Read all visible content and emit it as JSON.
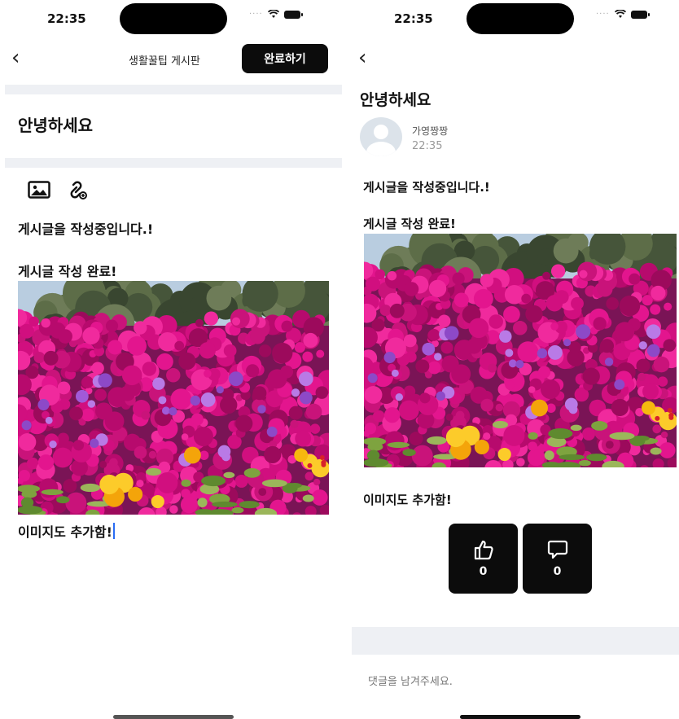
{
  "left": {
    "status_time": "22:35",
    "header_title": "생활꿀팁 게시판",
    "done_button": "완료하기",
    "post_title": "안녕하세요",
    "body_line1": "게시글을 작성중입니다.!",
    "body_line2": "게시글 작성 완료!",
    "body_line3": "이미지도 추가함!"
  },
  "right": {
    "status_time": "22:35",
    "post_title": "안녕하세요",
    "author_name": "가영짱짱",
    "post_time": "22:35",
    "body_line1": "게시글을 작성중입니다.!",
    "body_line2": "게시글 작성 완료!",
    "body_line3": "이미지도 추가함!",
    "like_count": "0",
    "comment_count": "0",
    "comment_placeholder": "댓글을 남겨주세요."
  }
}
